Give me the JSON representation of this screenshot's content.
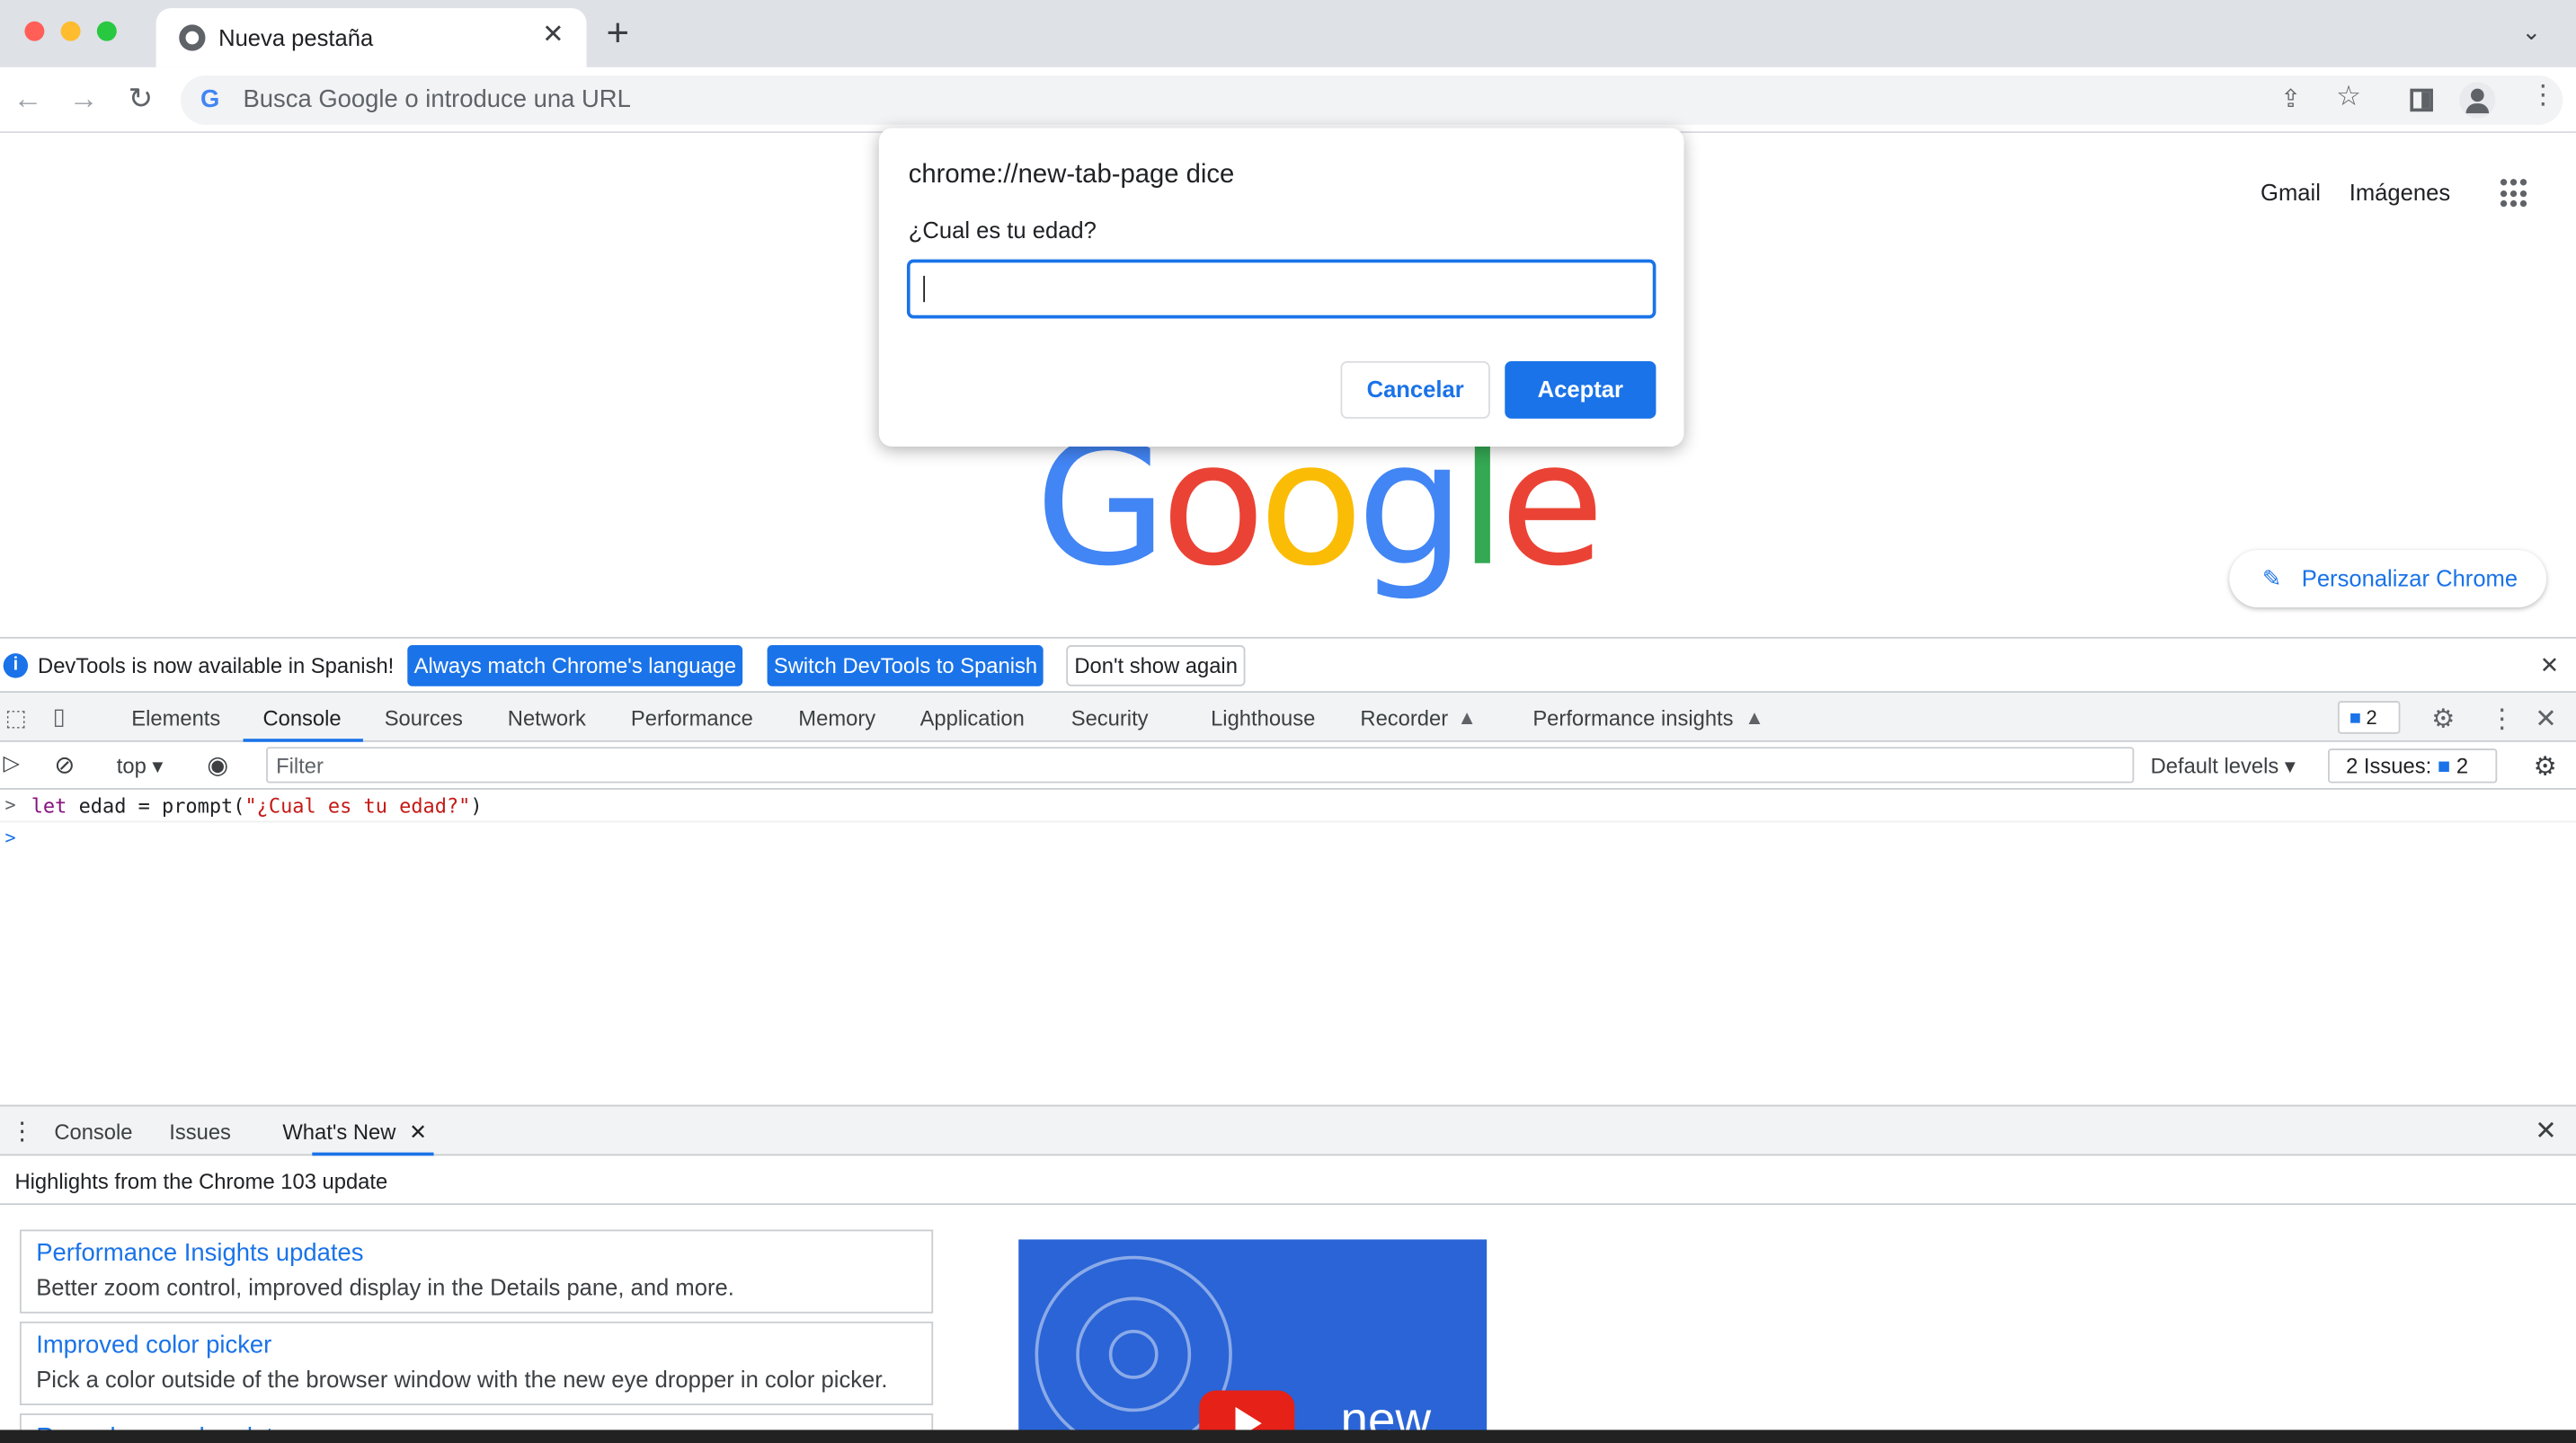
{
  "browser": {
    "tab_title": "Nueva pestaña",
    "tab_close": "✕",
    "new_tab": "+",
    "omnibox_placeholder": "Busca Google o introduce una URL"
  },
  "page": {
    "links": [
      "Gmail",
      "Imágenes"
    ],
    "logo_letters": [
      {
        "char": "G",
        "color": "#4285f4"
      },
      {
        "char": "o",
        "color": "#ea4335"
      },
      {
        "char": "o",
        "color": "#fbbc05"
      },
      {
        "char": "g",
        "color": "#4285f4"
      },
      {
        "char": "l",
        "color": "#34a853"
      },
      {
        "char": "e",
        "color": "#ea4335"
      }
    ],
    "customize_label": "Personalizar Chrome"
  },
  "dialog": {
    "title": "chrome://new-tab-page dice",
    "message": "¿Cual es tu edad?",
    "input_value": "",
    "cancel_label": "Cancelar",
    "ok_label": "Aceptar"
  },
  "devtools": {
    "infobar": {
      "text": "DevTools is now available in Spanish!",
      "btn_match": "Always match Chrome's language",
      "btn_switch": "Switch DevTools to Spanish",
      "btn_dont_show": "Don't show again"
    },
    "panels": [
      "Elements",
      "Console",
      "Sources",
      "Network",
      "Performance",
      "Memory",
      "Application",
      "Security",
      "Lighthouse",
      "Recorder",
      "Performance insights"
    ],
    "active_panel": "Console",
    "issues_badge_count": "2",
    "console_toolbar": {
      "context": "top",
      "filter_placeholder": "Filter",
      "levels": "Default levels",
      "issues_label": "2 Issues:",
      "issues_count": "2"
    },
    "console_lines": [
      {
        "keyword": "let",
        "rest": " edad = prompt(",
        "string": "\"¿Cual es tu edad?\"",
        "end": ")"
      }
    ],
    "drawer": {
      "tabs": [
        "Console",
        "Issues",
        "What's New"
      ],
      "active_tab": "What's New",
      "header": "Highlights from the Chrome 103 update",
      "cards": [
        {
          "title": "Performance Insights updates",
          "desc": "Better zoom control, improved display in the Details pane, and more."
        },
        {
          "title": "Improved color picker",
          "desc": "Pick a color outside of the browser window with the new eye dropper in color picker."
        },
        {
          "title": "Recorder panel updates",
          "desc": ""
        }
      ],
      "video_text": "new"
    }
  }
}
